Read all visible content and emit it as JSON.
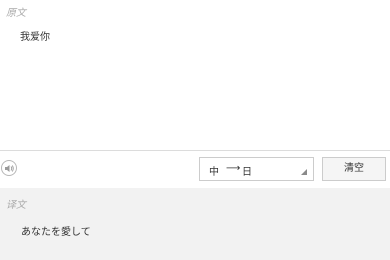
{
  "source": {
    "label": "原文",
    "text": "我爱你"
  },
  "toolbar": {
    "speaker_icon": "speaker-icon",
    "language": {
      "from": "中",
      "arrow": "⟶",
      "to": "日"
    },
    "clear_label": "清空"
  },
  "target": {
    "label": "译文",
    "text": "あなたを愛して"
  }
}
